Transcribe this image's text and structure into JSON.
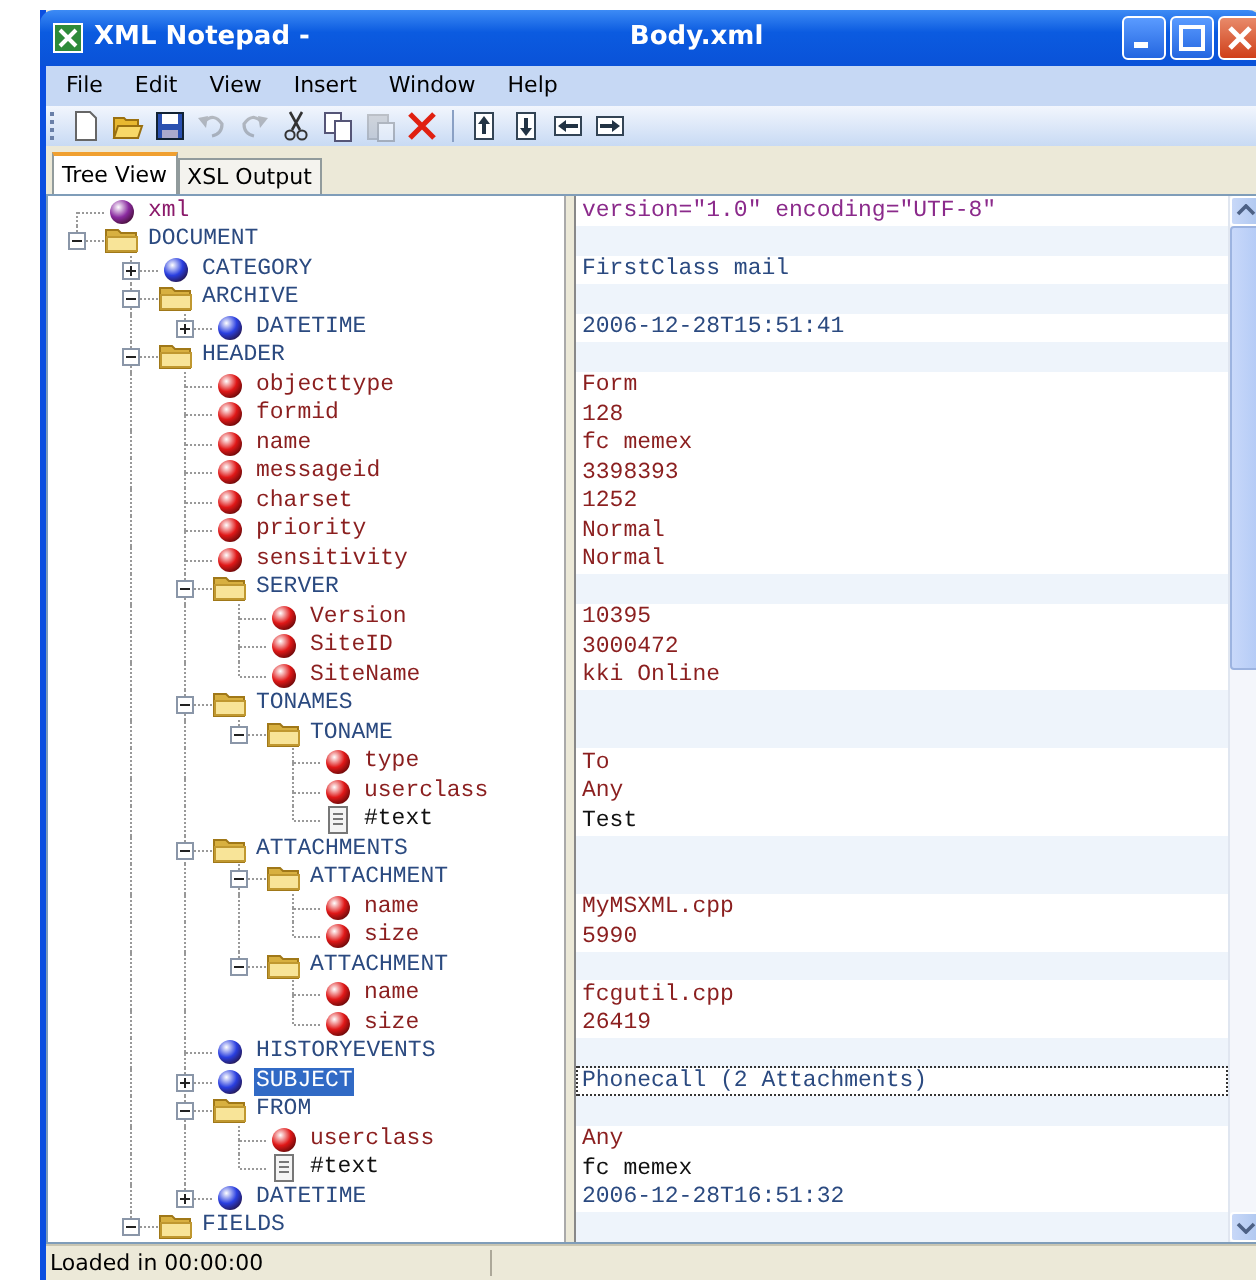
{
  "window": {
    "title_app": "XML Notepad -",
    "title_file": "Body.xml"
  },
  "menu": [
    "File",
    "Edit",
    "View",
    "Insert",
    "Window",
    "Help"
  ],
  "toolbar": [
    {
      "kind": "new",
      "disabled": false
    },
    {
      "kind": "open",
      "disabled": false
    },
    {
      "kind": "save",
      "disabled": false
    },
    {
      "kind": "undo",
      "disabled": true
    },
    {
      "kind": "redo",
      "disabled": true
    },
    {
      "kind": "cut",
      "disabled": false
    },
    {
      "kind": "copy",
      "disabled": false
    },
    {
      "kind": "paste",
      "disabled": true
    },
    {
      "kind": "delete",
      "disabled": false
    },
    {
      "kind": "separator"
    },
    {
      "kind": "nudge-up",
      "disabled": false
    },
    {
      "kind": "nudge-down",
      "disabled": false
    },
    {
      "kind": "nudge-left",
      "disabled": false
    },
    {
      "kind": "nudge-right",
      "disabled": false
    }
  ],
  "tabs": [
    {
      "label": "Tree View",
      "selected": true
    },
    {
      "label": "XSL Output",
      "selected": false
    }
  ],
  "tree": {
    "nodes": [
      {
        "name": "xml",
        "kind": "pi",
        "selected": false,
        "value": "version=\"1.0\" encoding=\"UTF-8\""
      },
      {
        "name": "DOCUMENT",
        "kind": "folder",
        "expanded": true,
        "selected": false,
        "children": [
          {
            "name": "CATEGORY",
            "kind": "element",
            "expanded": false,
            "selected": false,
            "value": "FirstClass mail"
          },
          {
            "name": "ARCHIVE",
            "kind": "folder",
            "expanded": true,
            "selected": false,
            "children": [
              {
                "name": "DATETIME",
                "kind": "element",
                "expanded": false,
                "selected": false,
                "value": "2006-12-28T15:51:41"
              }
            ]
          },
          {
            "name": "HEADER",
            "kind": "folder",
            "expanded": true,
            "selected": false,
            "children": [
              {
                "name": "objecttype",
                "kind": "attribute",
                "selected": false,
                "value": "Form"
              },
              {
                "name": "formid",
                "kind": "attribute",
                "selected": false,
                "value": "128"
              },
              {
                "name": "name",
                "kind": "attribute",
                "selected": false,
                "value": "fc memex"
              },
              {
                "name": "messageid",
                "kind": "attribute",
                "selected": false,
                "value": "3398393"
              },
              {
                "name": "charset",
                "kind": "attribute",
                "selected": false,
                "value": "1252"
              },
              {
                "name": "priority",
                "kind": "attribute",
                "selected": false,
                "value": "Normal"
              },
              {
                "name": "sensitivity",
                "kind": "attribute",
                "selected": false,
                "value": "Normal"
              },
              {
                "name": "SERVER",
                "kind": "folder",
                "expanded": true,
                "selected": false,
                "children": [
                  {
                    "name": "Version",
                    "kind": "attribute",
                    "selected": false,
                    "value": "10395"
                  },
                  {
                    "name": "SiteID",
                    "kind": "attribute",
                    "selected": false,
                    "value": "3000472"
                  },
                  {
                    "name": "SiteName",
                    "kind": "attribute",
                    "selected": false,
                    "value": "kki Online"
                  }
                ]
              },
              {
                "name": "TONAMES",
                "kind": "folder",
                "expanded": true,
                "selected": false,
                "children": [
                  {
                    "name": "TONAME",
                    "kind": "folder",
                    "expanded": true,
                    "selected": false,
                    "children": [
                      {
                        "name": "type",
                        "kind": "attribute",
                        "selected": false,
                        "value": "To"
                      },
                      {
                        "name": "userclass",
                        "kind": "attribute",
                        "selected": false,
                        "value": "Any"
                      },
                      {
                        "name": "#text",
                        "kind": "text",
                        "selected": false,
                        "value": "Test"
                      }
                    ]
                  }
                ]
              },
              {
                "name": "ATTACHMENTS",
                "kind": "folder",
                "expanded": true,
                "selected": false,
                "children": [
                  {
                    "name": "ATTACHMENT",
                    "kind": "folder",
                    "expanded": true,
                    "selected": false,
                    "children": [
                      {
                        "name": "name",
                        "kind": "attribute",
                        "selected": false,
                        "value": "MyMSXML.cpp"
                      },
                      {
                        "name": "size",
                        "kind": "attribute",
                        "selected": false,
                        "value": "5990"
                      }
                    ]
                  },
                  {
                    "name": "ATTACHMENT",
                    "kind": "folder",
                    "expanded": true,
                    "selected": false,
                    "children": [
                      {
                        "name": "name",
                        "kind": "attribute",
                        "selected": false,
                        "value": "fcgutil.cpp"
                      },
                      {
                        "name": "size",
                        "kind": "attribute",
                        "selected": false,
                        "value": "26419"
                      }
                    ]
                  }
                ]
              },
              {
                "name": "HISTORYEVENTS",
                "kind": "element",
                "selected": false
              },
              {
                "name": "SUBJECT",
                "kind": "element",
                "expanded": false,
                "selected": true,
                "value": "Phonecall (2 Attachments)"
              },
              {
                "name": "FROM",
                "kind": "folder",
                "expanded": true,
                "selected": false,
                "children": [
                  {
                    "name": "userclass",
                    "kind": "attribute",
                    "selected": false,
                    "value": "Any"
                  },
                  {
                    "name": "#text",
                    "kind": "text",
                    "selected": false,
                    "value": "fc memex"
                  }
                ]
              },
              {
                "name": "DATETIME",
                "kind": "element",
                "expanded": false,
                "selected": false,
                "value": "2006-12-28T16:51:32"
              }
            ]
          },
          {
            "name": "FIELDS",
            "kind": "folder",
            "expanded": true,
            "selected": false
          }
        ]
      }
    ]
  },
  "status_bar": {
    "text": "Loaded in 00:00:00"
  }
}
